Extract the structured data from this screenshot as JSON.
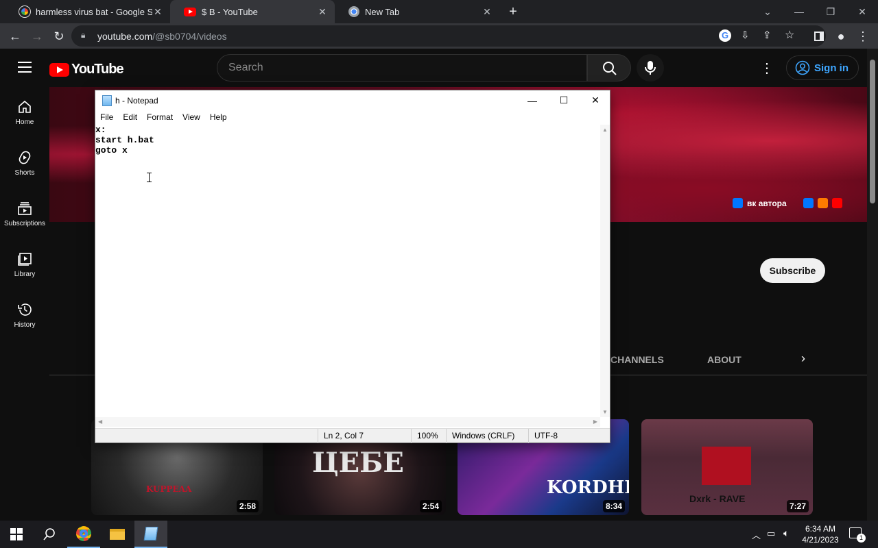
{
  "browser": {
    "tabs": [
      {
        "title": "harmless virus bat - Google Search",
        "favicon": "google-icon"
      },
      {
        "title": "$ B - YouTube",
        "favicon": "youtube-icon"
      },
      {
        "title": "New Tab",
        "favicon": "chrome-icon"
      }
    ],
    "url_host": "youtube.com",
    "url_path": "/@sb0704/videos"
  },
  "youtube": {
    "logo": "YouTube",
    "search_placeholder": "Search",
    "signin": "Sign in",
    "guide": [
      {
        "label": "Home",
        "icon": "home-icon"
      },
      {
        "label": "Shorts",
        "icon": "shorts-icon"
      },
      {
        "label": "Subscriptions",
        "icon": "subscriptions-icon"
      },
      {
        "label": "Library",
        "icon": "library-icon"
      },
      {
        "label": "History",
        "icon": "history-icon"
      }
    ],
    "banner_link": "вк автора",
    "subscribe": "Subscribe",
    "channel_tabs": [
      "CHANNELS",
      "ABOUT"
    ],
    "videos": [
      {
        "duration": "2:58"
      },
      {
        "duration": "2:54"
      },
      {
        "duration": "8:34"
      },
      {
        "duration": "7:27"
      }
    ]
  },
  "notepad": {
    "title": "h - Notepad",
    "menu": [
      "File",
      "Edit",
      "Format",
      "View",
      "Help"
    ],
    "content": "x:\nstart h.bat\ngoto x",
    "status": {
      "position": "Ln 2, Col 7",
      "zoom": "100%",
      "line_ending": "Windows (CRLF)",
      "encoding": "UTF-8"
    }
  },
  "taskbar": {
    "time": "6:34 AM",
    "date": "4/21/2023",
    "notifications": "1"
  }
}
